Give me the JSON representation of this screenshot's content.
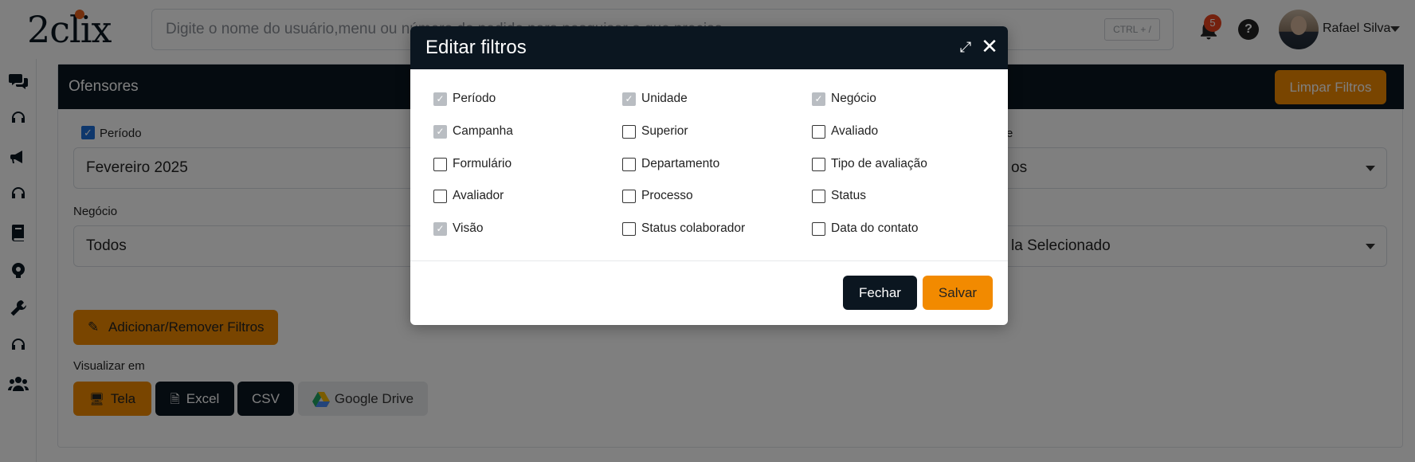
{
  "header": {
    "logo": "2clix",
    "search_placeholder": "Digite o nome do usuário,menu ou número do pedido para pesquisar o que precisa",
    "shortcut": "CTRL + /",
    "notifications_count": "5",
    "help_symbol": "?",
    "user_name": "Rafael Silva"
  },
  "sidebar": {
    "icons": [
      "chat-icon",
      "headset-icon",
      "megaphone-icon",
      "headset-icon",
      "book-icon",
      "gear-brain-icon",
      "wrench-icon",
      "headset-icon",
      "users-icon"
    ]
  },
  "main": {
    "title": "Ofensores",
    "clear_button": "Limpar Filtros",
    "periodo_label": "Período",
    "periodo_value": "Fevereiro 2025",
    "right_label_partial": "e",
    "right_select_partial": "os",
    "negocio_label": "Negócio",
    "negocio_value": "Todos",
    "right_select2_partial": "la Selecionado",
    "add_remove_button": "Adicionar/Remover Filtros",
    "view_label": "Visualizar em",
    "view_buttons": [
      {
        "label": "Tela"
      },
      {
        "label": "Excel"
      },
      {
        "label": "CSV"
      },
      {
        "label": "Google Drive"
      }
    ]
  },
  "modal": {
    "title": "Editar filtros",
    "options": [
      {
        "label": "Período",
        "checked": true
      },
      {
        "label": "Unidade",
        "checked": true
      },
      {
        "label": "Negócio",
        "checked": true
      },
      {
        "label": "Campanha",
        "checked": true
      },
      {
        "label": "Superior",
        "checked": false
      },
      {
        "label": "Avaliado",
        "checked": false
      },
      {
        "label": "Formulário",
        "checked": false
      },
      {
        "label": "Departamento",
        "checked": false
      },
      {
        "label": "Tipo de avaliação",
        "checked": false
      },
      {
        "label": "Avaliador",
        "checked": false
      },
      {
        "label": "Processo",
        "checked": false
      },
      {
        "label": "Status",
        "checked": false
      },
      {
        "label": "Visão",
        "checked": true
      },
      {
        "label": "Status colaborador",
        "checked": false
      },
      {
        "label": "Data do contato",
        "checked": false
      }
    ],
    "close_button": "Fechar",
    "save_button": "Salvar"
  },
  "colors": {
    "navy": "#0b1620",
    "orange": "#f28a00",
    "checked_gray": "#b9bdc2",
    "blue_check": "#1d6fd8"
  }
}
